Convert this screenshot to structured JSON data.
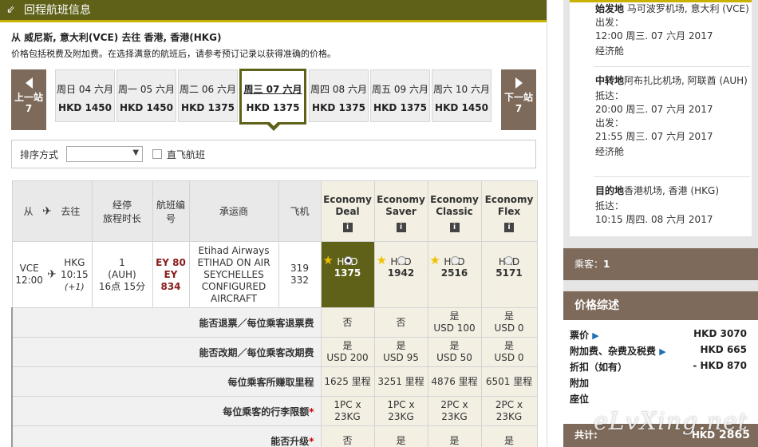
{
  "header": {
    "title": "回程航班信息"
  },
  "route_text": "从 威尼斯, 意大利(VCE) 去往 香港, 香港(HKG)",
  "price_note": "价格包括税费及附加费。在选择满意的航班后，请参考预订记录以获得准确的价格。",
  "date_nav": {
    "prev": {
      "line1": "上一站",
      "line2": "7"
    },
    "next": {
      "line1": "下一站",
      "line2": "7"
    },
    "days": [
      {
        "date": "周日 04 六月",
        "price": "HKD 1450"
      },
      {
        "date": "周一 05 六月",
        "price": "HKD 1450"
      },
      {
        "date": "周二 06 六月",
        "price": "HKD 1375"
      },
      {
        "date": "周三 07 六月",
        "price": "HKD 1375"
      },
      {
        "date": "周四 08 六月",
        "price": "HKD 1375"
      },
      {
        "date": "周五 09 六月",
        "price": "HKD 1375"
      },
      {
        "date": "周六 10 六月",
        "price": "HKD 1450"
      }
    ]
  },
  "sort": {
    "label": "排序方式",
    "selected": "",
    "nonstop_label": "直飞航班"
  },
  "table": {
    "headers": {
      "from": "从",
      "to": "去往",
      "stops": "经停",
      "duration": "旅程时长",
      "flight_no": "航班编号",
      "carrier": "承运商",
      "aircraft": "飞机",
      "fares": [
        "Economy Deal",
        "Economy Saver",
        "Economy Classic",
        "Economy Flex"
      ],
      "info": "i"
    },
    "flight": {
      "dep_code": "VCE",
      "dep_time": "12:00",
      "arr_code": "HKG",
      "arr_time": "10:15",
      "arr_day": "(+1)",
      "stops": "1",
      "via": "(AUH)",
      "duration": "16点 15分",
      "flight_nos": [
        "EY 80",
        "EY 834"
      ],
      "carrier_lines": [
        "Etihad Airways",
        "ETIHAD ON AIR",
        "SEYCHELLES",
        "CONFIGURED",
        "AIRCRAFT"
      ],
      "aircraft": [
        "319",
        "332"
      ],
      "fares": [
        {
          "currency": "HKD",
          "amount": "1375",
          "star": true,
          "selected": true
        },
        {
          "currency": "HKD",
          "amount": "1942",
          "star": true,
          "selected": false
        },
        {
          "currency": "HKD",
          "amount": "2516",
          "star": true,
          "selected": false
        },
        {
          "currency": "HKD",
          "amount": "5171",
          "star": false,
          "selected": false
        }
      ]
    },
    "details": [
      {
        "label": "能否退票／每位乘客退票费",
        "required": false,
        "values": [
          [
            "否"
          ],
          [
            "否"
          ],
          [
            "是",
            "USD 100"
          ],
          [
            "是",
            "USD 0"
          ]
        ]
      },
      {
        "label": "能否改期／每位乘客改期费",
        "required": false,
        "values": [
          [
            "是",
            "USD 200"
          ],
          [
            "是",
            "USD 95"
          ],
          [
            "是",
            "USD 50"
          ],
          [
            "是",
            "USD 0"
          ]
        ]
      },
      {
        "label": "每位乘客所赚取里程",
        "required": false,
        "values": [
          [
            "1625 里程"
          ],
          [
            "3251 里程"
          ],
          [
            "4876 里程"
          ],
          [
            "6501 里程"
          ]
        ]
      },
      {
        "label": "每位乘客的行李限额",
        "required": true,
        "values": [
          [
            "1PC x",
            "23KG"
          ],
          [
            "1PC x",
            "23KG"
          ],
          [
            "2PC x",
            "23KG"
          ],
          [
            "2PC x",
            "23KG"
          ]
        ]
      },
      {
        "label": "能否升级",
        "required": true,
        "values": [
          [
            "否"
          ],
          [
            "是"
          ],
          [
            "是"
          ],
          [
            "是"
          ]
        ]
      }
    ]
  },
  "itinerary": {
    "origin": {
      "title": "始发地",
      "place": "马可波罗机场, 意大利 (VCE)",
      "dep_label": "出发：",
      "dep_time": "12:00 周三. 07 六月 2017",
      "cabin": "经济舱"
    },
    "transit": {
      "title": "中转地",
      "place": "阿布扎比机场, 阿联酋 (AUH)",
      "arr_label": "抵达：",
      "arr_time": "20:00 周三. 07 六月 2017",
      "dep_label": "出发：",
      "dep_time": "21:55 周三. 07 六月 2017",
      "cabin": "经济舱"
    },
    "destination": {
      "title": "目的地",
      "place": "香港机场, 香港 (HKG)",
      "arr_label": "抵达：",
      "arr_time": "10:15 周四. 08 六月 2017"
    }
  },
  "passengers": {
    "label": "乘客：",
    "count": "1"
  },
  "price_summary": {
    "title": "价格综述",
    "lines": [
      {
        "label": "票价",
        "amount": "HKD 3070",
        "arrow": true
      },
      {
        "label": "附加费、杂费及税费",
        "amount": "HKD 665",
        "arrow": true
      },
      {
        "label": "折扣（如有）",
        "amount": "- HKD 870",
        "arrow": false
      },
      {
        "label": "附加",
        "amount": "",
        "arrow": false
      },
      {
        "label": "座位",
        "amount": "",
        "arrow": false
      }
    ],
    "total_label": "共计:",
    "total_currency": "HKD",
    "total_amount": "2865"
  },
  "watermark": "eLvXing.net",
  "colors": {
    "olive": "#5e6117",
    "brown": "#7d6a5a",
    "gold": "#c9b100",
    "fare_bg": "#f3efe3"
  }
}
